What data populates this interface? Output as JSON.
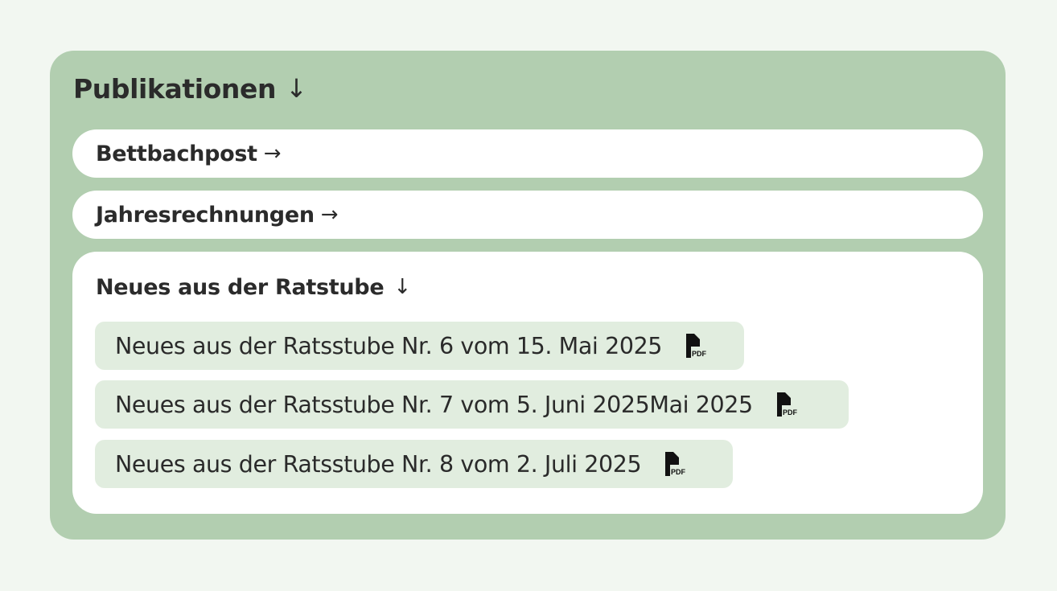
{
  "section": {
    "title": "Publikationen",
    "arrow": "↓"
  },
  "links": [
    {
      "label": "Bettbachpost",
      "arrow": "→"
    },
    {
      "label": "Jahresrechnungen",
      "arrow": "→"
    }
  ],
  "ratstube": {
    "title": "Neues aus der Ratstube",
    "arrow": "↓",
    "documents": [
      {
        "label": "Neues aus der Ratsstube Nr. 6 vom 15. Mai 2025",
        "icon": "pdf-file-icon"
      },
      {
        "label": "Neues aus der Ratsstube Nr. 7 vom 5. Juni 2025Mai 2025",
        "icon": "pdf-file-icon"
      },
      {
        "label": "Neues aus der Ratsstube Nr. 8 vom 2. Juli 2025",
        "icon": "pdf-file-icon"
      }
    ]
  },
  "colors": {
    "page_background": "#f2f7f1",
    "panel_background": "#b2ceb0",
    "card_background": "#ffffff",
    "document_background": "#e1eddf",
    "text": "#2b2b2b"
  }
}
